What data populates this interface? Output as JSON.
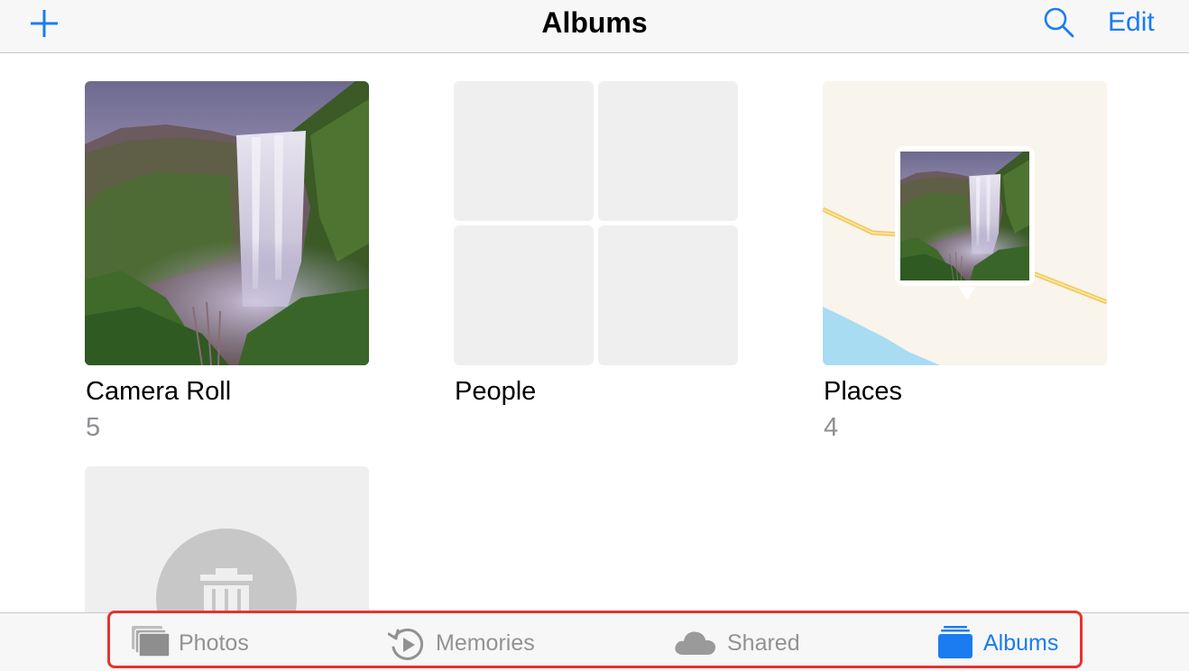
{
  "navbar": {
    "title": "Albums",
    "edit_label": "Edit",
    "add_icon": "plus-icon",
    "search_icon": "search-icon"
  },
  "albums": [
    {
      "title": "Camera Roll",
      "count": "5",
      "thumb": "waterfall-photo"
    },
    {
      "title": "People",
      "count": "",
      "thumb": "people-placeholder-grid"
    },
    {
      "title": "Places",
      "count": "4",
      "thumb": "map-with-photo-pin"
    },
    {
      "title": "",
      "count": "",
      "thumb": "trash-placeholder"
    }
  ],
  "tabbar": {
    "tabs": [
      {
        "label": "Photos",
        "icon": "photos-icon",
        "active": false
      },
      {
        "label": "Memories",
        "icon": "memories-icon",
        "active": false
      },
      {
        "label": "Shared",
        "icon": "cloud-icon",
        "active": false
      },
      {
        "label": "Albums",
        "icon": "albums-icon",
        "active": true
      }
    ]
  },
  "colors": {
    "accent": "#1a7cf0",
    "inactive": "#929292",
    "highlight_border": "#e8322e",
    "bar_background": "#f7f7f7",
    "placeholder": "#efeff0"
  }
}
